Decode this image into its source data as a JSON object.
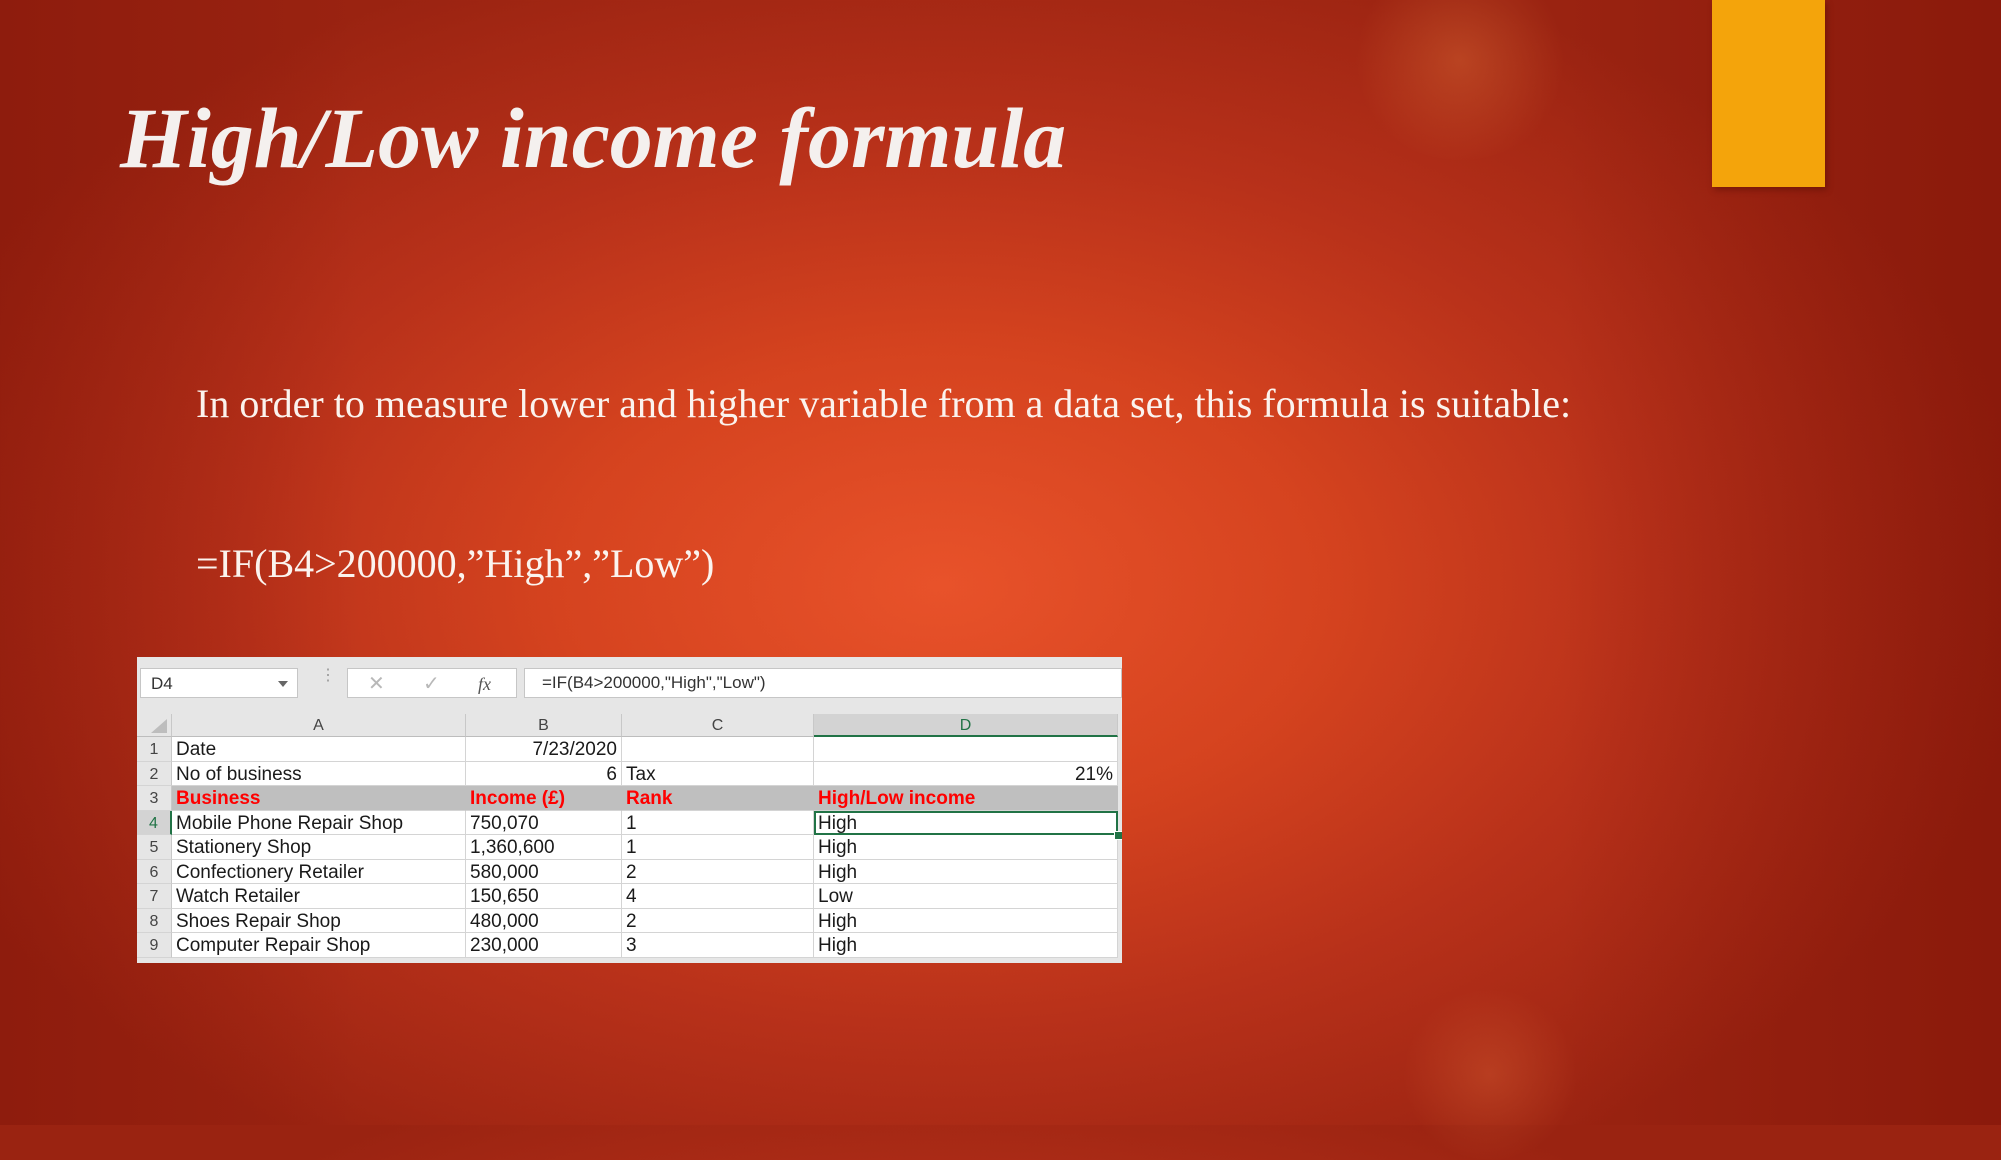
{
  "slide": {
    "title": "High/Low income formula",
    "body_paragraph": "In order to measure lower and higher variable from a data set, this formula is suitable:",
    "formula_text": "=IF(B4>200000,”High”,”Low”)",
    "colors": {
      "background": "#d5431f",
      "accent_bar": "#f4a40b",
      "text": "#fbf3ee"
    }
  },
  "spreadsheet": {
    "name_box": "D4",
    "icons": {
      "cancel": "close-icon",
      "enter": "check-icon",
      "function": "fx-icon",
      "dropdown": "chevron-down-icon"
    },
    "formula_bar": "=IF(B4>200000,\"High\",\"Low\")",
    "columns": [
      "A",
      "B",
      "C",
      "D"
    ],
    "selected_column": "D",
    "selected_row": "4",
    "rows": [
      {
        "num": "1",
        "cells": [
          "Date",
          "7/23/2020",
          "",
          ""
        ]
      },
      {
        "num": "2",
        "cells": [
          "No of business",
          "6",
          "Tax",
          "21%"
        ]
      },
      {
        "num": "3",
        "cells": [
          "Business",
          "Income (£)",
          "Rank",
          "High/Low income"
        ]
      },
      {
        "num": "4",
        "cells": [
          "Mobile Phone Repair Shop",
          "750,070",
          "1",
          "High"
        ]
      },
      {
        "num": "5",
        "cells": [
          "Stationery Shop",
          "1,360,600",
          "1",
          "High"
        ]
      },
      {
        "num": "6",
        "cells": [
          "Confectionery Retailer",
          "580,000",
          "2",
          "High"
        ]
      },
      {
        "num": "7",
        "cells": [
          "Watch Retailer",
          "150,650",
          "4",
          "Low"
        ]
      },
      {
        "num": "8",
        "cells": [
          "Shoes Repair Shop",
          "480,000",
          "2",
          "High"
        ]
      },
      {
        "num": "9",
        "cells": [
          "Computer Repair Shop",
          "230,000",
          "3",
          "High"
        ]
      }
    ],
    "colors": {
      "header_row_bg": "#bfbfbf",
      "header_row_text": "#ff0000",
      "selection": "#217346"
    }
  }
}
